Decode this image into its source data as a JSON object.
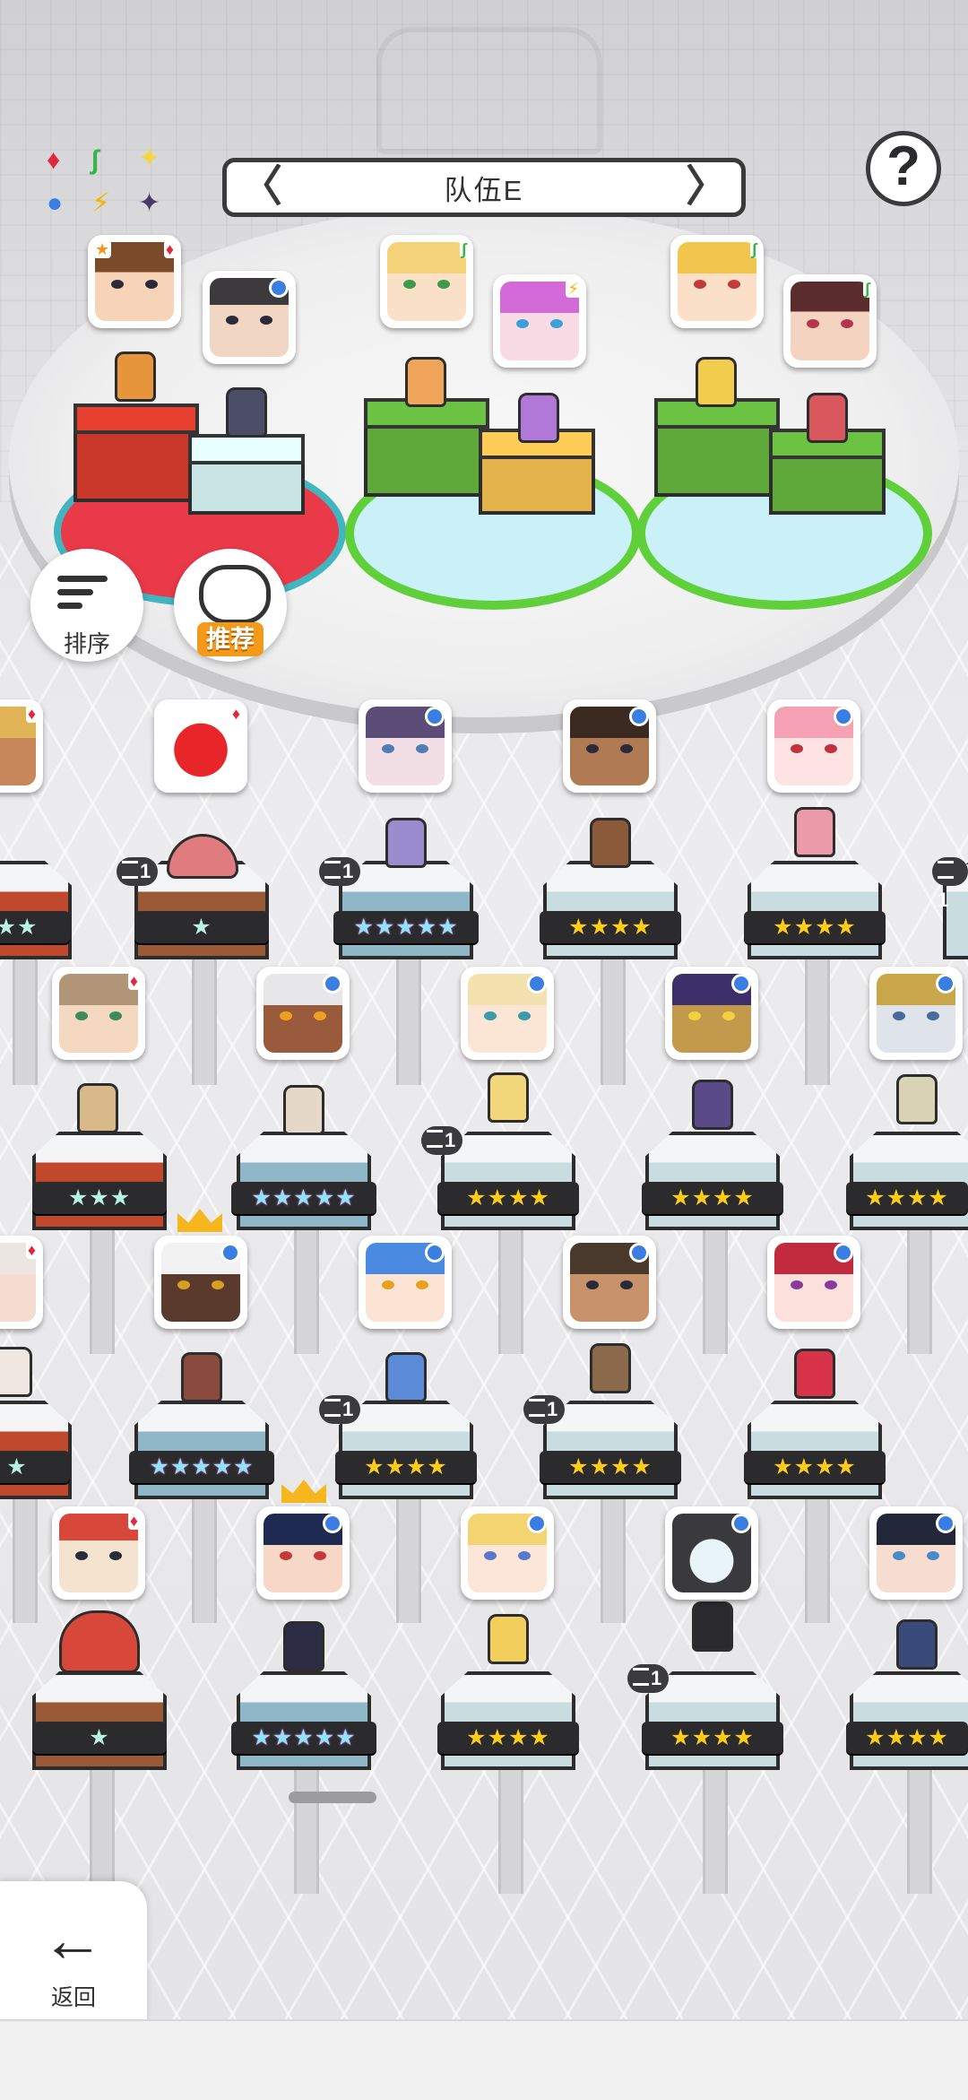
{
  "team": {
    "title": "队伍E",
    "prev_label": "〈",
    "next_label": "〉"
  },
  "help_label": "?",
  "sort_button": {
    "label": "排序"
  },
  "recommend_button": {
    "label": "推荐"
  },
  "back_button": {
    "label": "返回",
    "arrow": "←"
  },
  "affinity_icons": [
    "diamond-red-icon",
    "leaf-green-icon",
    "sparkle-yellow-icon",
    "water-blue-icon",
    "bolt-yellow-icon",
    "sparkle-purple-icon"
  ],
  "colors": {
    "red_element": "#e2283c",
    "water_element": "#3a7de3",
    "leaf_element": "#39b44a",
    "star_gold": "#ffcc17",
    "recommend_orange": "#f39a1a"
  },
  "party_slots": [
    {
      "element": "red",
      "members": [
        "brown-haired-boy",
        "glasses-man"
      ]
    },
    {
      "element": "green",
      "members": [
        "blonde-elf-girl",
        "pink-haired-girl"
      ]
    },
    {
      "element": "green",
      "members": [
        "blonde-girl",
        "red-haired-girl"
      ]
    }
  ],
  "roster_rows": [
    {
      "heroes": [
        {
          "name": "blonde-tan-girl",
          "stars": "★★",
          "dup": ""
        },
        {
          "name": "red-slime",
          "stars": "★",
          "dup": "1"
        },
        {
          "name": "purple-haired-woman",
          "stars": "★★★★★",
          "dup": "1"
        },
        {
          "name": "dark-skinned-girl",
          "stars": "★★★★",
          "dup": ""
        },
        {
          "name": "pink-haired-skull-girl",
          "stars": "★★★★",
          "dup": ""
        },
        {
          "name": "edge-hero",
          "stars": "",
          "dup": "1"
        }
      ]
    },
    {
      "heroes": [
        {
          "name": "hat-adventurer",
          "stars": "★★★",
          "dup": ""
        },
        {
          "name": "white-haired-tan-girl",
          "stars": "★★★★★",
          "dup": ""
        },
        {
          "name": "blonde-nun",
          "stars": "★★★★",
          "dup": "1"
        },
        {
          "name": "purple-masked-warrior",
          "stars": "★★★★",
          "dup": ""
        },
        {
          "name": "silver-armored-knight",
          "stars": "★★★★",
          "dup": ""
        }
      ]
    },
    {
      "heroes": [
        {
          "name": "white-haired-girl",
          "stars": "★",
          "dup": ""
        },
        {
          "name": "dark-elf",
          "stars": "★★★★★",
          "dup": ""
        },
        {
          "name": "blue-haired-mermaid",
          "stars": "★★★★",
          "dup": "1"
        },
        {
          "name": "bearded-warrior",
          "stars": "★★★★",
          "dup": "1"
        },
        {
          "name": "red-haired-woman",
          "stars": "★★★★",
          "dup": ""
        }
      ]
    },
    {
      "heroes": [
        {
          "name": "mushroom-man",
          "stars": "★",
          "dup": ""
        },
        {
          "name": "black-haired-girl",
          "stars": "★★★★★",
          "dup": ""
        },
        {
          "name": "blonde-alice",
          "stars": "★★★★",
          "dup": ""
        },
        {
          "name": "golden-mage",
          "stars": "★★★★",
          "dup": "1"
        },
        {
          "name": "dark-haired-girl",
          "stars": "★★★★",
          "dup": ""
        }
      ]
    }
  ]
}
